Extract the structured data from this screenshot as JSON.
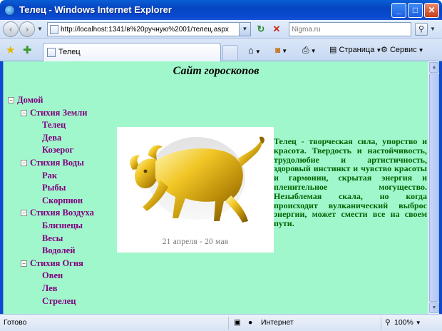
{
  "window": {
    "title": "Телец - Windows Internet Explorer"
  },
  "address_bar": {
    "url": "http://localhost:1341/в%20ручную%2001/телец.aspx"
  },
  "search": {
    "placeholder": "Nigma.ru"
  },
  "tab": {
    "label": "Телец"
  },
  "toolbar": {
    "page_label": "Страница",
    "tools_label": "Сервис"
  },
  "page": {
    "title": "Сайт гороскопов",
    "tree": {
      "root": "Домой",
      "groups": [
        {
          "label": "Стихия Земли",
          "items": [
            "Телец",
            "Дева",
            "Козерог"
          ]
        },
        {
          "label": "Стихия Воды",
          "items": [
            "Рак",
            "Рыбы",
            "Скорпион"
          ]
        },
        {
          "label": "Стихия Воздуха",
          "items": [
            "Близнецы",
            "Весы",
            "Водолей"
          ]
        },
        {
          "label": "Стихия Огня",
          "items": [
            "Овен",
            "Лев",
            "Стрелец"
          ]
        }
      ]
    },
    "image_caption": "21 апреля - 20 мая",
    "description": "Телец - творческая сила, упорство и красота. Твердость и настойчивость, трудолюбие и артистичность, здоровый инстинкт и чувство красоты и гармонии, скрытая энергия и пленительное могущество. Незыблемая скала, но когда происходит вулканический выброс энергии, может смести все на своем пути."
  },
  "status_bar": {
    "status": "Готово",
    "zone": "Интернет",
    "zoom": "100%"
  },
  "colors": {
    "page_background": "#a1f7cc",
    "tree_link": "#800080",
    "description_text": "#006400"
  }
}
